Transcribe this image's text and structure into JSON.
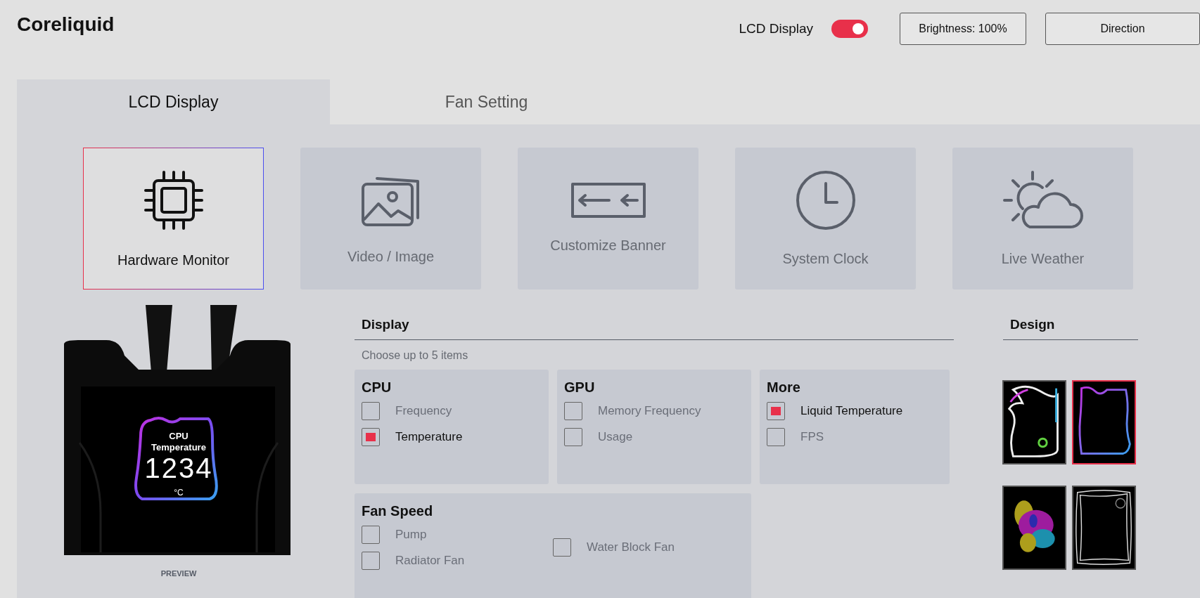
{
  "app": {
    "title": "Coreliquid"
  },
  "header": {
    "lcd_toggle": {
      "label": "LCD Display",
      "on": true
    },
    "buttons": [
      "Brightness: 100%",
      "Direction"
    ]
  },
  "tabs": [
    {
      "label": "LCD Display",
      "selected": true
    },
    {
      "label": "Fan Setting",
      "selected": false
    }
  ],
  "modes": [
    {
      "kind": "chip",
      "label": "Hardware Monitor",
      "selected": true
    },
    {
      "kind": "image",
      "label": "Video / Image",
      "selected": false
    },
    {
      "kind": "banner",
      "label": "Customize Banner",
      "selected": false
    },
    {
      "kind": "clock",
      "label": "System Clock",
      "selected": false
    },
    {
      "kind": "weather",
      "label": "Live Weather",
      "selected": false
    }
  ],
  "preview": {
    "screen_title": "CPU Temperature",
    "screen_value": "1234",
    "screen_unit": "°C",
    "label": "PREVIEW"
  },
  "display": {
    "heading": "Display",
    "hint": "Choose up to 5 items",
    "groups": [
      {
        "title": "CPU",
        "columns": [
          [
            {
              "label": "Frequency",
              "checked": false
            },
            {
              "label": "Temperature",
              "checked": true
            }
          ]
        ]
      },
      {
        "title": "GPU",
        "columns": [
          [
            {
              "label": "Memory Frequency",
              "checked": false
            },
            {
              "label": "Usage",
              "checked": false
            }
          ]
        ]
      },
      {
        "title": "More",
        "columns": [
          [
            {
              "label": "Liquid Temperature",
              "checked": true
            },
            {
              "label": "FPS",
              "checked": false
            }
          ]
        ]
      },
      {
        "title": "Fan Speed",
        "wide": true,
        "columns": [
          [
            {
              "label": "Pump",
              "checked": false
            },
            {
              "label": "Radiator Fan",
              "checked": false
            }
          ],
          [
            {
              "label": "Water Block Fan",
              "checked": false
            }
          ]
        ]
      }
    ]
  },
  "design": {
    "heading": "Design",
    "items": [
      {
        "kind": "glow",
        "selected": false
      },
      {
        "kind": "neon",
        "selected": true
      },
      {
        "kind": "smoke",
        "selected": false
      },
      {
        "kind": "lines",
        "selected": false
      }
    ]
  }
}
